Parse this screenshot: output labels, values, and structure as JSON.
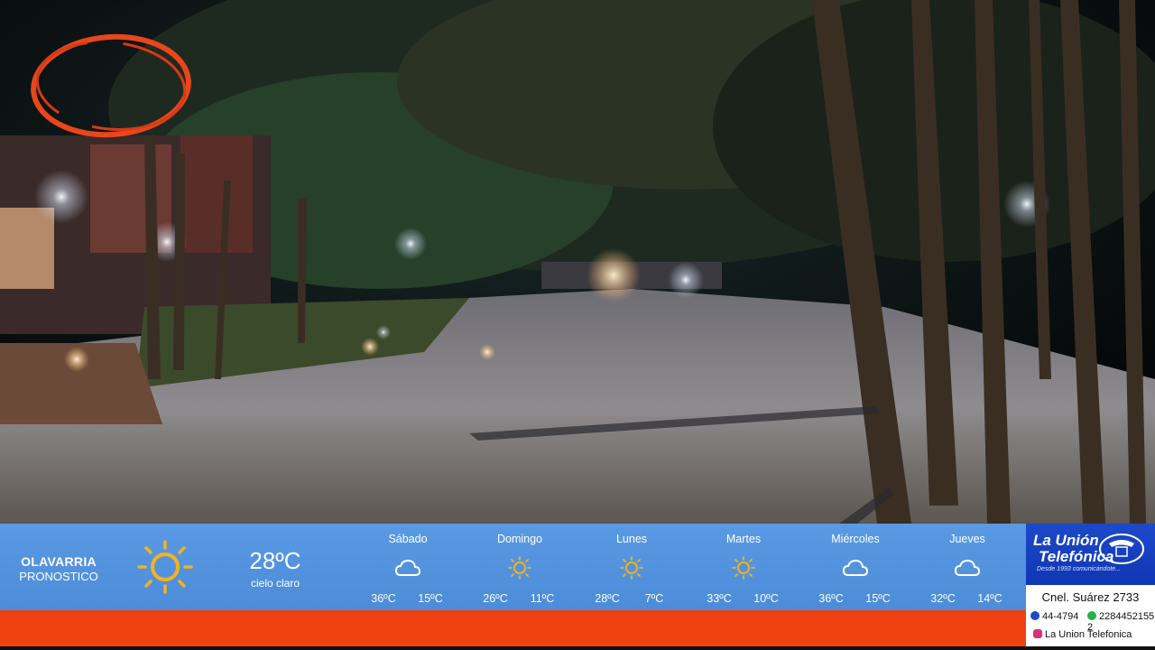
{
  "weather": {
    "city": "OLAVARRIA",
    "subtitle": "PRONOSTICO",
    "current": {
      "temp": "28ºC",
      "desc": "cielo claro",
      "icon": "sun-icon"
    },
    "days": [
      {
        "name": "Sábado",
        "icon": "cloud-icon",
        "high": "36ºC",
        "low": "15ºC"
      },
      {
        "name": "Domingo",
        "icon": "sun-icon",
        "high": "26ºC",
        "low": "11ºC"
      },
      {
        "name": "Lunes",
        "icon": "sun-icon",
        "high": "28ºC",
        "low": "7ºC"
      },
      {
        "name": "Martes",
        "icon": "sun-icon",
        "high": "33ºC",
        "low": "10ºC"
      },
      {
        "name": "Miércoles",
        "icon": "cloud-icon",
        "high": "36ºC",
        "low": "15ºC"
      },
      {
        "name": "Jueves",
        "icon": "cloud-icon",
        "high": "32ºC",
        "low": "14ºC"
      }
    ],
    "colors": {
      "bar": "#4c8cd8",
      "sun": "#f5b21b",
      "strip": "#ef4210"
    }
  },
  "sponsor": {
    "brand_line1": "La Unión",
    "brand_line2": "Telefónica",
    "tagline": "Desde 1993 comunicándote...",
    "address": "Cnel. Suárez 2733",
    "phone": "44-4794",
    "whatsapp": "2284452155 2",
    "facebook": "La Union Telefonica"
  }
}
